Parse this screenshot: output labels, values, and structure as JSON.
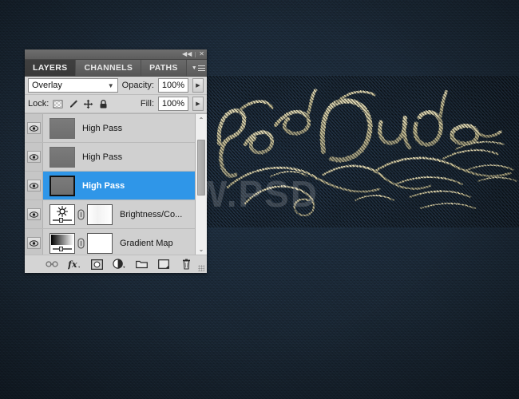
{
  "window": {
    "titlebar": {
      "collapse_icon": "collapse-to-icons",
      "close_icon": "close"
    }
  },
  "panel": {
    "tabs": [
      {
        "label": "LAYERS",
        "active": true
      },
      {
        "label": "CHANNELS",
        "active": false
      },
      {
        "label": "PATHS",
        "active": false
      }
    ],
    "menu_icon": "panel-menu",
    "blend_mode": {
      "value": "Overlay",
      "chevron": "⌄"
    },
    "opacity": {
      "label": "Opacity:",
      "value": "100%",
      "spinner": "▶"
    },
    "lock": {
      "label": "Lock:",
      "icons": [
        "lock-transparency",
        "lock-image-pixels",
        "lock-position",
        "lock-all"
      ]
    },
    "fill": {
      "label": "Fill:",
      "value": "100%",
      "spinner": "▶"
    },
    "layers": [
      {
        "name": "High Pass",
        "type": "pixel",
        "visible": true,
        "selected": false
      },
      {
        "name": "High Pass",
        "type": "pixel",
        "visible": true,
        "selected": false
      },
      {
        "name": "High Pass",
        "type": "pixel",
        "visible": true,
        "selected": true
      },
      {
        "name": "Brightness/Co...",
        "type": "brightness-contrast",
        "visible": true,
        "selected": false
      },
      {
        "name": "Gradient Map",
        "type": "gradient-map",
        "visible": true,
        "selected": false
      }
    ],
    "scrollbar": {
      "up_arrow": "⌃",
      "down_arrow": "⌄"
    },
    "bottom_tools": [
      {
        "name": "link-layers",
        "glyph": "link"
      },
      {
        "name": "add-layer-style",
        "glyph": "fx"
      },
      {
        "name": "add-layer-mask",
        "glyph": "mask"
      },
      {
        "name": "new-fill-adjustment-layer",
        "glyph": "adjustment"
      },
      {
        "name": "new-group",
        "glyph": "folder"
      },
      {
        "name": "new-layer",
        "glyph": "new-layer"
      },
      {
        "name": "delete-layer",
        "glyph": "trash"
      }
    ]
  },
  "canvas": {
    "artwork_text": "PsdDude",
    "watermark": "WWW.PSD",
    "colors": {
      "denim": "#1a2a3a",
      "gold": "#d8cb8a",
      "selection_blue": "#2f96e8",
      "panel_gray": "#d4d4d4"
    }
  }
}
